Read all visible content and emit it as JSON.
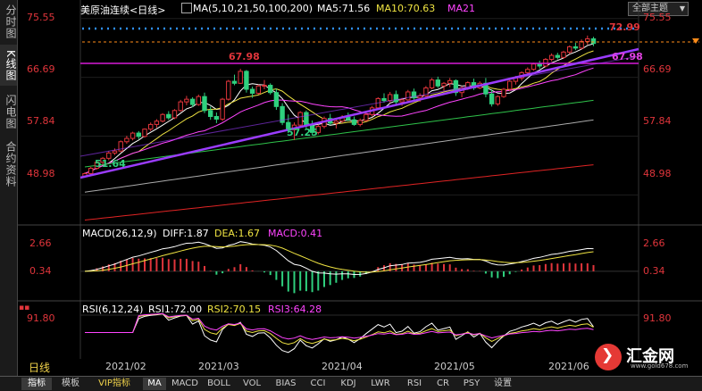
{
  "sidebar": {
    "tabs": [
      {
        "label": "分时图",
        "active": false
      },
      {
        "label": "K线图",
        "active": true
      },
      {
        "label": "闪电图",
        "active": false
      },
      {
        "label": "合约资料",
        "active": false
      }
    ]
  },
  "header": {
    "instrument": "美原油连续<日线>",
    "ma_title": "MA(5,10,21,50,100,200)",
    "ma5": "MA5:71.56",
    "ma10": "MA10:70.63",
    "ma21": "MA21",
    "theme_select": "全部主题"
  },
  "colors": {
    "up": "#e0353b",
    "down": "#2fd07e",
    "ma5": "#ffffff",
    "ma10": "#f0e442",
    "ma21": "#ff44ff",
    "ma50": "#2fc24a",
    "ma100": "#aaaaaa",
    "ma200": "#e02424",
    "trendline": "#9b3cff",
    "resistance": "#d81bd8",
    "dotted": "#2f8ff5",
    "current": "#ff8c1a"
  },
  "chart_data": {
    "type": "candlestick",
    "main_axis": {
      "ticks": [
        "75.55",
        "66.69",
        "57.84",
        "48.98"
      ],
      "ylim": [
        45.0,
        77.0
      ]
    },
    "annotations": {
      "high_label": "72.99",
      "peak_label": "67.98",
      "right_label": "67.98",
      "low_label": "57.25",
      "start_label": "51.64"
    },
    "candles": [
      [
        51.8,
        52.4,
        51.6,
        52.2
      ],
      [
        52.2,
        53.2,
        52.0,
        53.0
      ],
      [
        53.0,
        54.2,
        52.8,
        53.9
      ],
      [
        53.9,
        54.7,
        53.6,
        54.5
      ],
      [
        54.5,
        55.6,
        54.2,
        55.3
      ],
      [
        55.3,
        56.0,
        55.0,
        55.6
      ],
      [
        55.6,
        57.2,
        55.4,
        57.0
      ],
      [
        57.0,
        57.9,
        56.7,
        57.5
      ],
      [
        57.5,
        58.5,
        57.2,
        58.3
      ],
      [
        58.3,
        58.6,
        57.4,
        57.8
      ],
      [
        57.8,
        59.0,
        57.6,
        58.9
      ],
      [
        58.9,
        59.9,
        58.6,
        59.6
      ],
      [
        59.6,
        60.4,
        59.1,
        60.1
      ],
      [
        60.1,
        61.3,
        59.9,
        61.1
      ],
      [
        61.1,
        61.6,
        60.3,
        60.6
      ],
      [
        60.6,
        61.9,
        60.4,
        61.7
      ],
      [
        61.7,
        63.3,
        61.5,
        63.0
      ],
      [
        63.0,
        63.9,
        62.5,
        63.4
      ],
      [
        63.4,
        63.7,
        62.2,
        62.6
      ],
      [
        62.6,
        64.1,
        62.4,
        63.8
      ],
      [
        63.8,
        64.4,
        61.3,
        61.7
      ],
      [
        61.7,
        62.3,
        60.3,
        60.8
      ],
      [
        60.8,
        61.4,
        59.8,
        60.4
      ],
      [
        60.4,
        63.6,
        60.1,
        63.4
      ],
      [
        63.4,
        66.3,
        63.2,
        66.1
      ],
      [
        66.1,
        67.1,
        65.5,
        65.8
      ],
      [
        65.8,
        67.98,
        65.7,
        67.6
      ],
      [
        67.6,
        67.8,
        64.4,
        64.9
      ],
      [
        64.9,
        65.3,
        63.6,
        64.3
      ],
      [
        64.3,
        65.6,
        64.1,
        65.4
      ],
      [
        65.4,
        66.3,
        64.9,
        65.5
      ],
      [
        65.5,
        65.8,
        64.1,
        64.4
      ],
      [
        64.4,
        65.0,
        61.8,
        62.3
      ],
      [
        62.3,
        62.8,
        59.5,
        59.9
      ],
      [
        59.9,
        61.1,
        58.3,
        58.8
      ],
      [
        58.8,
        59.9,
        57.25,
        59.5
      ],
      [
        59.5,
        61.6,
        59.2,
        61.4
      ],
      [
        61.4,
        61.7,
        58.9,
        59.4
      ],
      [
        59.4,
        60.2,
        58.0,
        58.4
      ],
      [
        58.4,
        59.6,
        58.1,
        59.3
      ],
      [
        59.3,
        60.8,
        59.0,
        60.5
      ],
      [
        60.5,
        61.2,
        59.5,
        59.8
      ],
      [
        59.8,
        60.4,
        59.0,
        60.1
      ],
      [
        60.1,
        61.0,
        59.8,
        60.7
      ],
      [
        60.7,
        61.4,
        60.1,
        60.3
      ],
      [
        60.3,
        60.8,
        59.4,
        59.6
      ],
      [
        59.6,
        60.5,
        59.3,
        60.2
      ],
      [
        60.2,
        61.3,
        60.0,
        61.1
      ],
      [
        61.1,
        62.4,
        60.8,
        62.1
      ],
      [
        62.1,
        63.7,
        61.9,
        63.5
      ],
      [
        63.5,
        64.3,
        62.9,
        63.2
      ],
      [
        63.2,
        64.5,
        62.8,
        64.1
      ],
      [
        64.1,
        64.7,
        62.6,
        63.0
      ],
      [
        63.0,
        63.6,
        62.4,
        63.3
      ],
      [
        63.3,
        64.8,
        63.1,
        64.5
      ],
      [
        64.5,
        65.0,
        63.3,
        63.6
      ],
      [
        63.6,
        64.3,
        63.0,
        63.9
      ],
      [
        63.9,
        65.4,
        63.7,
        65.1
      ],
      [
        65.1,
        66.6,
        64.9,
        66.3
      ],
      [
        66.3,
        66.8,
        65.1,
        65.4
      ],
      [
        65.4,
        66.0,
        64.7,
        65.8
      ],
      [
        65.8,
        66.6,
        65.2,
        66.2
      ],
      [
        66.2,
        66.4,
        63.9,
        64.4
      ],
      [
        64.4,
        65.4,
        63.7,
        65.1
      ],
      [
        65.1,
        66.1,
        64.8,
        65.9
      ],
      [
        65.9,
        66.5,
        64.8,
        65.1
      ],
      [
        65.1,
        66.1,
        64.9,
        65.8
      ],
      [
        65.8,
        66.6,
        63.7,
        64.2
      ],
      [
        64.2,
        64.9,
        62.3,
        62.7
      ],
      [
        62.7,
        64.0,
        62.4,
        63.8
      ],
      [
        63.8,
        65.1,
        63.6,
        64.9
      ],
      [
        64.9,
        66.3,
        64.6,
        66.1
      ],
      [
        66.1,
        66.9,
        65.6,
        66.6
      ],
      [
        66.6,
        67.6,
        66.2,
        67.4
      ],
      [
        67.4,
        68.2,
        67.0,
        67.9
      ],
      [
        67.9,
        68.9,
        67.7,
        68.7
      ],
      [
        68.7,
        69.2,
        68.0,
        68.4
      ],
      [
        68.4,
        69.6,
        68.2,
        69.4
      ],
      [
        69.4,
        70.3,
        69.1,
        70.0
      ],
      [
        70.0,
        70.4,
        69.4,
        69.7
      ],
      [
        69.7,
        70.7,
        69.5,
        70.5
      ],
      [
        70.5,
        71.5,
        70.2,
        71.3
      ],
      [
        71.3,
        71.9,
        70.8,
        71.1
      ],
      [
        71.1,
        72.4,
        70.9,
        72.1
      ],
      [
        72.1,
        72.99,
        71.6,
        72.5
      ],
      [
        72.5,
        72.8,
        71.4,
        71.8
      ]
    ],
    "macd": {
      "title": "MACD(26,12,9)",
      "diff": "DIFF:1.87",
      "dea": "DEA:1.67",
      "macd": "MACD:0.41",
      "ticks": [
        "2.66",
        "0.34"
      ],
      "ylim": [
        -2.6,
        3.4
      ]
    },
    "rsi": {
      "title": "RSI(6,12,24)",
      "rsi1": "RSI1:72.00",
      "rsi2": "RSI2:70.15",
      "rsi3": "RSI3:64.28",
      "ticks": [
        "91.80"
      ],
      "ylim": [
        15,
        100
      ]
    },
    "x_ticks": [
      "2021/02",
      "2021/03",
      "2021/04",
      "2021/05",
      "2021/06"
    ],
    "x_tick_index": [
      5,
      28,
      56,
      79,
      99
    ]
  },
  "timeframe": "日线",
  "bottom_tabs": [
    {
      "label": "指标",
      "active": true
    },
    {
      "label": "模板"
    },
    {
      "label": "VIP指标",
      "vip": true
    },
    {
      "label": "MA"
    },
    {
      "label": "MACD"
    },
    {
      "label": "BOLL"
    },
    {
      "label": "VOL"
    },
    {
      "label": "BIAS"
    },
    {
      "label": "CCI"
    },
    {
      "label": "KDJ"
    },
    {
      "label": "LWR"
    },
    {
      "label": "RSI"
    },
    {
      "label": "CR"
    },
    {
      "label": "PSY"
    },
    {
      "label": "设置"
    }
  ],
  "logo": {
    "text": "汇金网",
    "url_text": "www.gold678.com"
  }
}
